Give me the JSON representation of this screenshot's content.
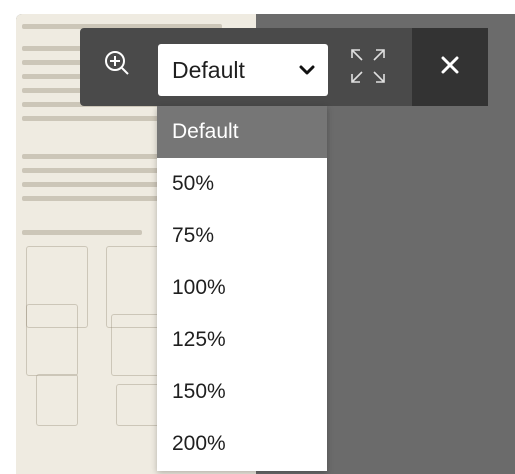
{
  "zoom": {
    "selected": "Default",
    "options": [
      "Default",
      "50%",
      "75%",
      "100%",
      "125%",
      "150%",
      "200%"
    ]
  },
  "icons": {
    "zoom": "zoom-in-icon",
    "dropdown": "chevron-down-icon",
    "fullscreen": "fullscreen-expand-icon",
    "close": "close-icon"
  },
  "colors": {
    "viewer_background": "#6b6b6b",
    "toolbar_background": "#4a4a4a",
    "close_button_background": "#333333",
    "selected_option_background": "#767676",
    "document_background": "#efebe1"
  }
}
